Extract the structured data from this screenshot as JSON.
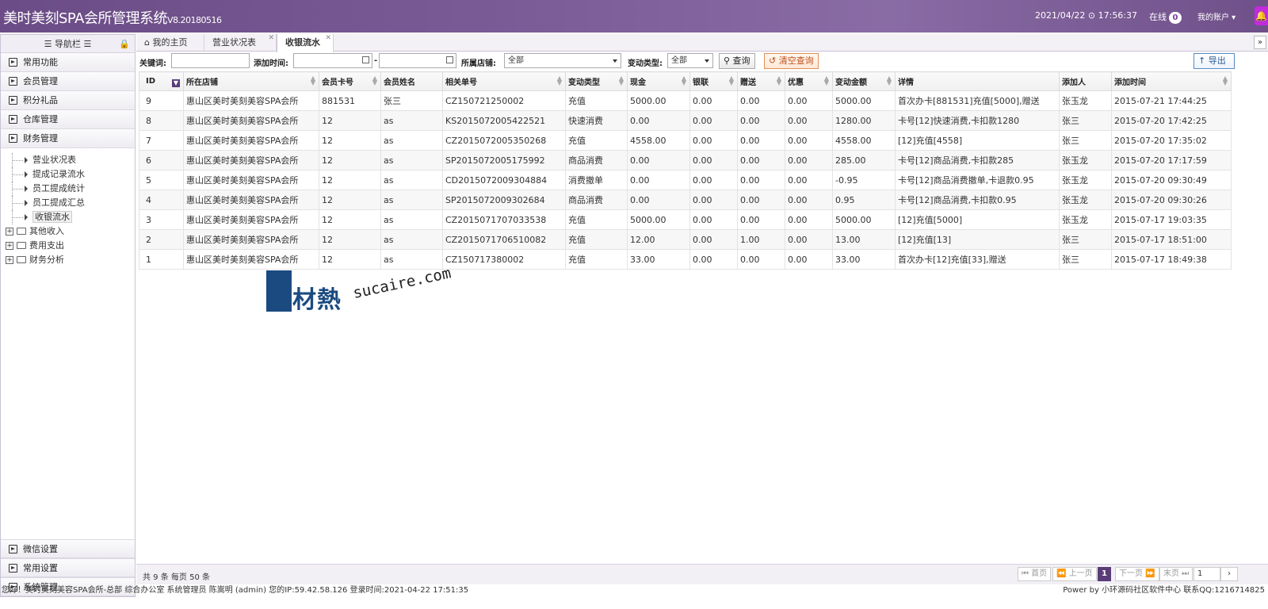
{
  "header": {
    "title": "美时美刻SPA会所管理系统",
    "version": "V8.20180516",
    "datetime": "2021/04/22 ⊙ 17:56:37",
    "online_label": "在线",
    "online_count": "0",
    "account_label": "我的账户 ▾"
  },
  "sidebar": {
    "title": "☰ 导航栏 ☰",
    "groups_top": [
      "常用功能",
      "会员管理",
      "积分礼品",
      "仓库管理",
      "财务管理"
    ],
    "tree_items": [
      "营业状况表",
      "提成记录流水",
      "员工提成统计",
      "员工提成汇总",
      "收银流水"
    ],
    "tree_folders": [
      "其他收入",
      "费用支出",
      "财务分析"
    ],
    "groups_bottom": [
      "微信设置",
      "常用设置",
      "系统管理"
    ]
  },
  "tabs": [
    {
      "label": "⌂ 我的主页"
    },
    {
      "label": "营业状况表"
    },
    {
      "label": "收银流水"
    }
  ],
  "filter": {
    "keyword_label": "关键词:",
    "addtime_label": "添加时间:",
    "shop_label": "所属店铺:",
    "shop_value": "全部",
    "type_label": "变动类型:",
    "type_value": "全部",
    "query_label": "⚲ 查询",
    "clear_label": "↺ 清空查询",
    "export_label": "↑ 导出"
  },
  "table": {
    "columns": [
      "ID",
      "所在店铺",
      "会员卡号",
      "会员姓名",
      "相关单号",
      "变动类型",
      "现金",
      "银联",
      "赠送",
      "优惠",
      "变动金额",
      "详情",
      "添加人",
      "添加时间"
    ],
    "rows": [
      [
        "9",
        "惠山区美时美刻美容SPA会所",
        "881531",
        "张三",
        "CZ150721250002",
        "充值",
        "5000.00",
        "0.00",
        "0.00",
        "0.00",
        "5000.00",
        "首次办卡[881531]充值[5000],赠送",
        "张玉龙",
        "2015-07-21 17:44:25"
      ],
      [
        "8",
        "惠山区美时美刻美容SPA会所",
        "12",
        "as",
        "KS2015072005422521",
        "快速消费",
        "0.00",
        "0.00",
        "0.00",
        "0.00",
        "1280.00",
        "卡号[12]快速消费,卡扣款1280",
        "张三",
        "2015-07-20 17:42:25"
      ],
      [
        "7",
        "惠山区美时美刻美容SPA会所",
        "12",
        "as",
        "CZ2015072005350268",
        "充值",
        "4558.00",
        "0.00",
        "0.00",
        "0.00",
        "4558.00",
        "[12]充值[4558]",
        "张三",
        "2015-07-20 17:35:02"
      ],
      [
        "6",
        "惠山区美时美刻美容SPA会所",
        "12",
        "as",
        "SP2015072005175992",
        "商品消费",
        "0.00",
        "0.00",
        "0.00",
        "0.00",
        "285.00",
        "卡号[12]商品消费,卡扣款285",
        "张玉龙",
        "2015-07-20 17:17:59"
      ],
      [
        "5",
        "惠山区美时美刻美容SPA会所",
        "12",
        "as",
        "CD2015072009304884",
        "消费撤单",
        "0.00",
        "0.00",
        "0.00",
        "0.00",
        "-0.95",
        "卡号[12]商品消费撤单,卡退款0.95",
        "张玉龙",
        "2015-07-20 09:30:49"
      ],
      [
        "4",
        "惠山区美时美刻美容SPA会所",
        "12",
        "as",
        "SP2015072009302684",
        "商品消费",
        "0.00",
        "0.00",
        "0.00",
        "0.00",
        "0.95",
        "卡号[12]商品消费,卡扣款0.95",
        "张玉龙",
        "2015-07-20 09:30:26"
      ],
      [
        "3",
        "惠山区美时美刻美容SPA会所",
        "12",
        "as",
        "CZ2015071707033538",
        "充值",
        "5000.00",
        "0.00",
        "0.00",
        "0.00",
        "5000.00",
        "[12]充值[5000]",
        "张玉龙",
        "2015-07-17 19:03:35"
      ],
      [
        "2",
        "惠山区美时美刻美容SPA会所",
        "12",
        "as",
        "CZ2015071706510082",
        "充值",
        "12.00",
        "0.00",
        "1.00",
        "0.00",
        "13.00",
        "[12]充值[13]",
        "张三",
        "2015-07-17 18:51:00"
      ],
      [
        "1",
        "惠山区美时美刻美容SPA会所",
        "12",
        "as",
        "CZ150717380002",
        "充值",
        "33.00",
        "0.00",
        "0.00",
        "0.00",
        "33.00",
        "首次办卡[12]充值[33],赠送",
        "张三",
        "2015-07-17 18:49:38"
      ]
    ]
  },
  "watermark": {
    "cn": "素材熱",
    "en": "sucaire.com"
  },
  "pager": {
    "summary": "共 9 条 每页 50 条",
    "first": "⏮ 首页",
    "prev": "⏪ 上一页",
    "current": "1",
    "next": "下一页 ⏩",
    "last": "末页 ⏭",
    "page_input": "1",
    "go": "›"
  },
  "status": {
    "left": "您好！美时美刻美容SPA会所-总部 综合办公室 系统管理员 陈嵩明 (admin) 您的IP:59.42.58.126 登录时间:2021-04-22 17:51:35",
    "right": "Power by 小环源码社区软件中心 联系QQ:1216714825"
  },
  "colors": {
    "header": "#7a5b95",
    "accent": "#5a3c78",
    "bell": "#c02bdc"
  }
}
